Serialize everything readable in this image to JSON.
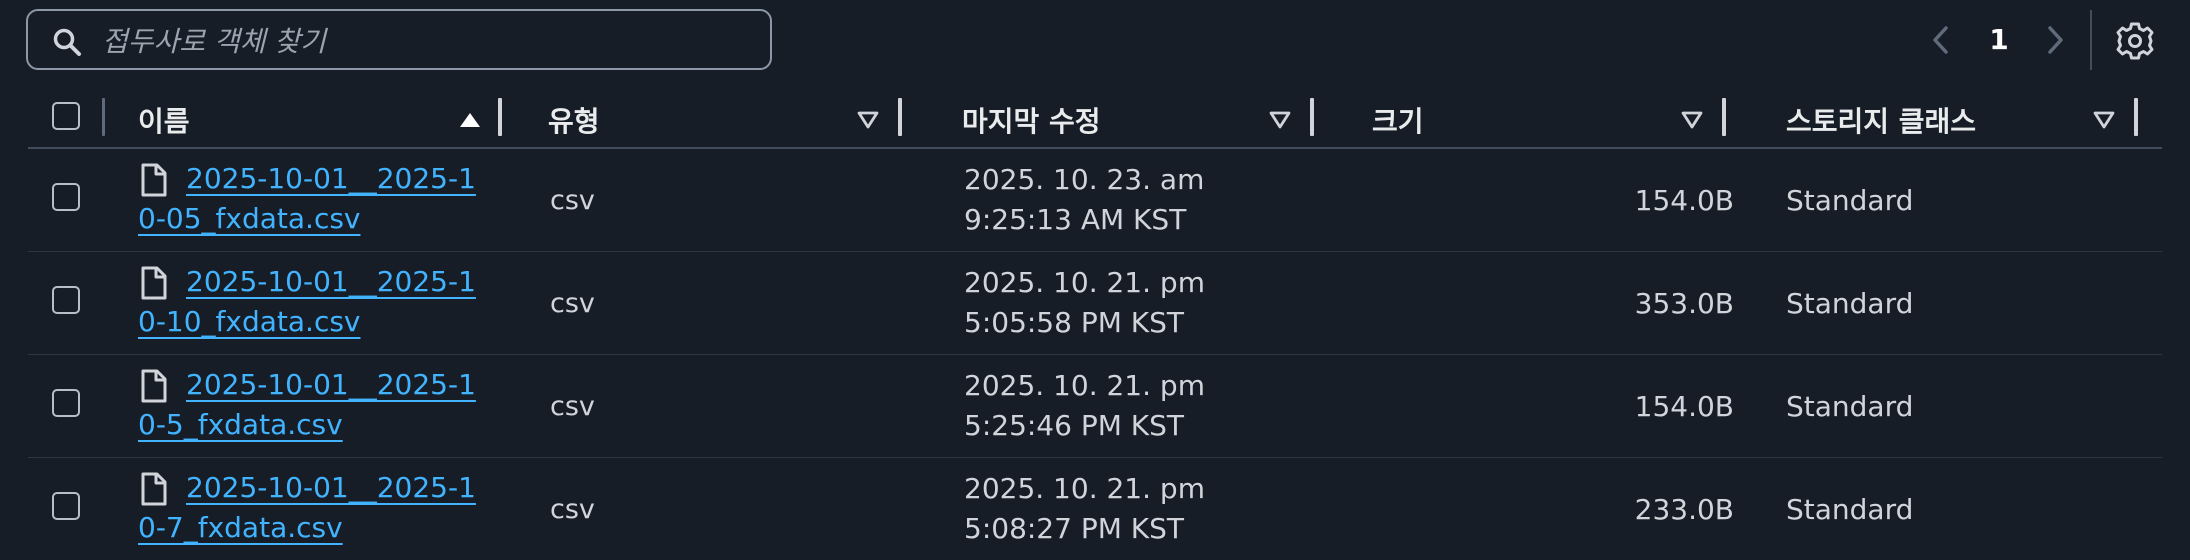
{
  "search": {
    "placeholder": "접두사로 객체 찾기",
    "value": ""
  },
  "pagination": {
    "current_page": "1",
    "prev_label": "Previous page",
    "next_label": "Next page"
  },
  "columns": [
    {
      "key": "name",
      "label": "이름",
      "sort": "ascending"
    },
    {
      "key": "type",
      "label": "유형",
      "sort": "none"
    },
    {
      "key": "modified",
      "label": "마지막 수정",
      "sort": "none"
    },
    {
      "key": "size",
      "label": "크기",
      "sort": "none"
    },
    {
      "key": "storage_class",
      "label": "스토리지 클래스",
      "sort": "none"
    }
  ],
  "rows": [
    {
      "name": "2025-10-01__2025-10-05_fxdata.csv",
      "type": "csv",
      "modified": "2025. 10. 23. am 9:25:13 AM KST",
      "size": "154.0B",
      "storage_class": "Standard"
    },
    {
      "name": "2025-10-01__2025-10-10_fxdata.csv",
      "type": "csv",
      "modified": "2025. 10. 21. pm 5:05:58 PM KST",
      "size": "353.0B",
      "storage_class": "Standard"
    },
    {
      "name": "2025-10-01__2025-10-5_fxdata.csv",
      "type": "csv",
      "modified": "2025. 10. 21. pm 5:25:46 PM KST",
      "size": "154.0B",
      "storage_class": "Standard"
    },
    {
      "name": "2025-10-01__2025-10-7_fxdata.csv",
      "type": "csv",
      "modified": "2025. 10. 21. pm 5:08:27 PM KST",
      "size": "233.0B",
      "storage_class": "Standard"
    }
  ],
  "colors": {
    "background": "#161d26",
    "link": "#42b4ff",
    "text": "#d1d5db",
    "divider": "#414d5c"
  },
  "icons": {
    "search": "search-icon",
    "file": "file-icon",
    "settings": "gear-icon",
    "prev": "chevron-left-icon",
    "next": "chevron-right-icon",
    "sort_asc": "sort-ascending-icon",
    "sort_none": "sort-down-icon"
  }
}
